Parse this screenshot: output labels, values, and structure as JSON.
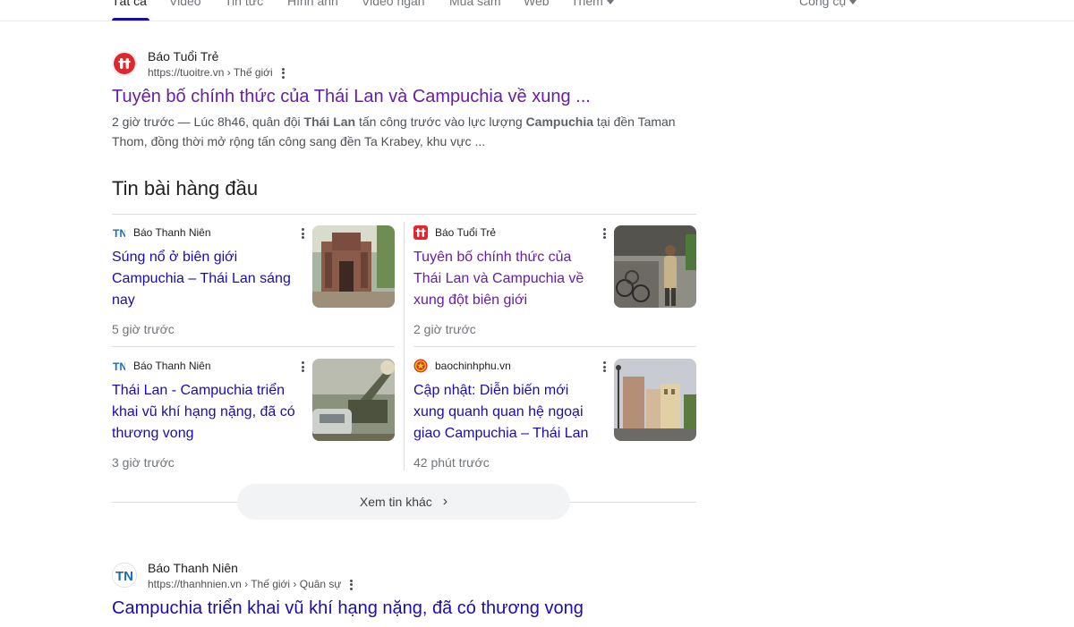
{
  "tabs": {
    "items": [
      "Tất cả",
      "Video",
      "Tin tức",
      "Hình ảnh",
      "Video ngắn",
      "Mua sắm",
      "Web",
      "Thêm"
    ],
    "tools": "Công cụ"
  },
  "result1": {
    "site_name": "Báo Tuổi Trẻ",
    "url": "https://tuoitre.vn › Thế giới",
    "title": "Tuyên bố chính thức của Thái Lan và Campuchia về xung ...",
    "snippet_time": "2 giờ trước — Lúc 8h46, quân đội ",
    "snippet_b1": "Thái Lan",
    "snippet_mid": " tấn công trước vào lực lượng ",
    "snippet_b2": "Campuchia",
    "snippet_end": " tại đền Taman Thom, đồng thời mở rộng tấn công sang đền Ta Krabey, khu vực ..."
  },
  "top_stories": {
    "heading": "Tin bài hàng đầu",
    "cards": [
      {
        "source": "Báo Thanh Niên",
        "title": "Súng nổ ở biên giới Campuchia – Thái Lan sáng nay",
        "time": "5 giờ trước",
        "thumb": "temple-ruins"
      },
      {
        "source": "Báo Tuổi Trẻ",
        "title": "Tuyên bố chính thức của Thái Lan và Campuchia về xung đột biên giới",
        "time": "2 giờ trước",
        "thumb": "soldier-street"
      },
      {
        "source": "Báo Thanh Niên",
        "title": "Thái Lan - Campuchia triển khai vũ khí hạng nặng, đã có thương vong",
        "time": "3 giờ trước",
        "thumb": "rocket-launcher"
      },
      {
        "source": "baochinhphu.vn",
        "title": "Cập nhật: Diễn biến mới xung quanh quan hệ ngoại giao Campuchia – Thái Lan",
        "time": "42 phút trước",
        "thumb": "city-street"
      }
    ],
    "more_label": "Xem tin khác"
  },
  "result2": {
    "site_name": "Báo Thanh Niên",
    "url": "https://thanhnien.vn › Thế giới › Quân sự",
    "title": "Campuchia triển khai vũ khí hạng nặng, đã có thương vong"
  },
  "colors": {
    "link": "#1a0dab",
    "visited": "#681da8",
    "tuoitre_red": "#e3262b",
    "thanhnien_blue": "#1d6bb5"
  }
}
